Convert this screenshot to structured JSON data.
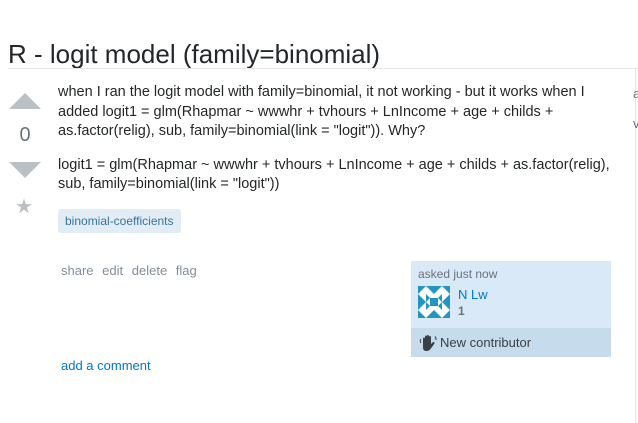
{
  "question": {
    "title": "R - logit model (family=binomial)",
    "vote_count": "0",
    "body": [
      "when I ran the logit model with family=binomial, it not working - but it works when I added logit1 = glm(Rhapmar ~ wwwhr + tvhours + LnIncome + age + childs + as.factor(relig), sub, family=binomial(link = \"logit\")). Why?",
      "logit1 = glm(Rhapmar ~ wwwhr + tvhours + LnIncome + age + childs + as.factor(relig), sub, family=binomial(link = \"logit\"))"
    ],
    "tags": [
      "binomial-coefficients"
    ]
  },
  "post_menu": {
    "share": "share",
    "edit": "edit",
    "delete": "delete",
    "flag": "flag"
  },
  "owner": {
    "asked": "asked just now",
    "name": "N Lw",
    "reputation": "1",
    "contributor_label": "New contributor",
    "avatar_colors": [
      "#2196c4",
      "#ffffff"
    ]
  },
  "comments": {
    "add_label": "add a comment"
  },
  "sidebar_fragments": [
    "a",
    "v"
  ],
  "icons": {
    "upvote": "arrow-up-icon",
    "downvote": "arrow-down-icon",
    "favorite": "star-icon",
    "contributor": "wave-hand-icon"
  },
  "colors": {
    "link": "#0077cc",
    "tag_bg": "#e1ecf4",
    "tag_text": "#39739d",
    "owner_bg": "#d9e9f7",
    "contrib_bg": "#c6dcec"
  }
}
